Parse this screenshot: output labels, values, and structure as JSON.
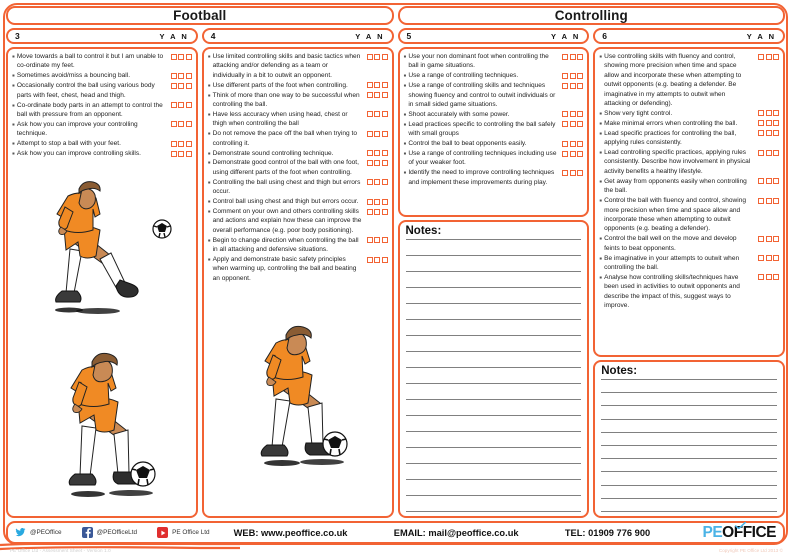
{
  "document": {
    "caption": "PE Office Ltd - Assessment Sheet - Version 1.0",
    "copyright": "Copyright PE Office Ltd 2013 ©"
  },
  "panels": [
    {
      "title": "Football",
      "columns": [
        {
          "level": "3",
          "yan": "Y A N",
          "criteria": [
            "Move towards a ball to control it but I am unable to co-ordinate my feet.",
            "Sometimes avoid/miss a bouncing ball.",
            "Occasionally control the ball using various body parts with feet, chest, head and thigh.",
            "Co-ordinate body parts in an attempt to control the ball with pressure from an opponent.",
            "Ask how you can improve your controlling technique.",
            "Attempt to stop a ball with your feet.",
            "Ask how you can improve controlling skills."
          ],
          "figures": [
            "footballer-raising-knee",
            "footballer-controlling-ball"
          ],
          "notes": null
        },
        {
          "level": "4",
          "yan": "Y A N",
          "criteria": [
            "Use limited controlling skills and basic tactics when attacking and/or defending as a team or individually in a bit to outwit an opponent.",
            "Use different parts of the foot when controlling.",
            "Think of more than one way to be successful when controlling the ball.",
            "Have less accuracy when using head, chest or thigh when controlling the ball",
            "Do not remove the pace off the ball when trying to controlling it.",
            "Demonstrate sound controlling technique.",
            "Demonstrate good control of the ball with one foot, using different parts of the foot when controlling.",
            "Controlling the ball using chest and thigh but errors occur.",
            "Control ball using chest and thigh but errors occur.",
            "Comment on your own and others controlling skills and actions and explain how these can improve the overall performance (e.g. poor body positioning).",
            "Begin to change direction when controlling the ball in all attacking and defensive situations.",
            "Apply and demonstrate basic safety principles when warming up, controlling the ball and beating an opponent."
          ],
          "figures": [
            "footballer-stopping-ball"
          ],
          "notes": null
        }
      ]
    },
    {
      "title": "Controlling",
      "columns": [
        {
          "level": "5",
          "yan": "Y A N",
          "criteria": [
            "Use your non dominant foot when controlling the ball in game situations.",
            "Use a range of controlling techniques.",
            "Use a range of controlling skills and techniques showing fluency and control to outwit individuals or in small sided game situations.",
            "Shoot accurately with some power.",
            "Lead practices specific to controlling the ball safely with small groups",
            "Control the ball to beat opponents easily.",
            "Use a range of controlling techniques including use of your weaker foot.",
            "Identify the need to improve controlling techniques and implement these improvements during play."
          ],
          "figures": [],
          "notes": {
            "title": "Notes:",
            "lines": 18
          }
        },
        {
          "level": "6",
          "yan": "Y A N",
          "criteria": [
            "Use controlling skills with fluency and control, showing more precision when time and space allow and incorporate these when attempting to outwit opponents (e.g. beating a defender. Be imaginative in my attempts to outwit when attacking or defending).",
            "Show very tight control.",
            "Make minimal errors when controlling the ball.",
            "Lead specific practices for controlling the ball, applying rules consistently.",
            "Lead controlling specific practices, applying rules consistently. Describe how involvement in physical activity benefits a healthy lifestyle.",
            "Get away from opponents easily when controlling the ball.",
            "Control the ball with fluency and control, showing more precision when time and space allow and incorporate these when attempting to outwit opponents (e.g. beating a defender).",
            "Control the ball well on the move and develop feints to beat opponents.",
            "Be imaginative in your attempts to outwit when controlling the ball.",
            "Analyse how controlling skills/techniques have been used in activities to outwit opponents and describe the impact of this, suggest ways to improve."
          ],
          "figures": [],
          "notes": {
            "title": "Notes:",
            "lines": 11
          }
        }
      ]
    }
  ],
  "footer": {
    "social": [
      {
        "icon": "twitter-icon",
        "handle": "@PEOffice"
      },
      {
        "icon": "facebook-icon",
        "handle": "@PEOfficeLtd"
      },
      {
        "icon": "youtube-icon",
        "handle": "PE Office Ltd"
      }
    ],
    "web": "WEB: www.peoffice.co.uk",
    "email": "EMAIL: mail@peoffice.co.uk",
    "tel": "TEL: 01909 776 900",
    "logo": {
      "part1": "PE",
      "part2": "OFFICE"
    }
  },
  "colors": {
    "accent": "#F26334",
    "logo_blue": "#4BB3E6",
    "rule": "#808080"
  }
}
